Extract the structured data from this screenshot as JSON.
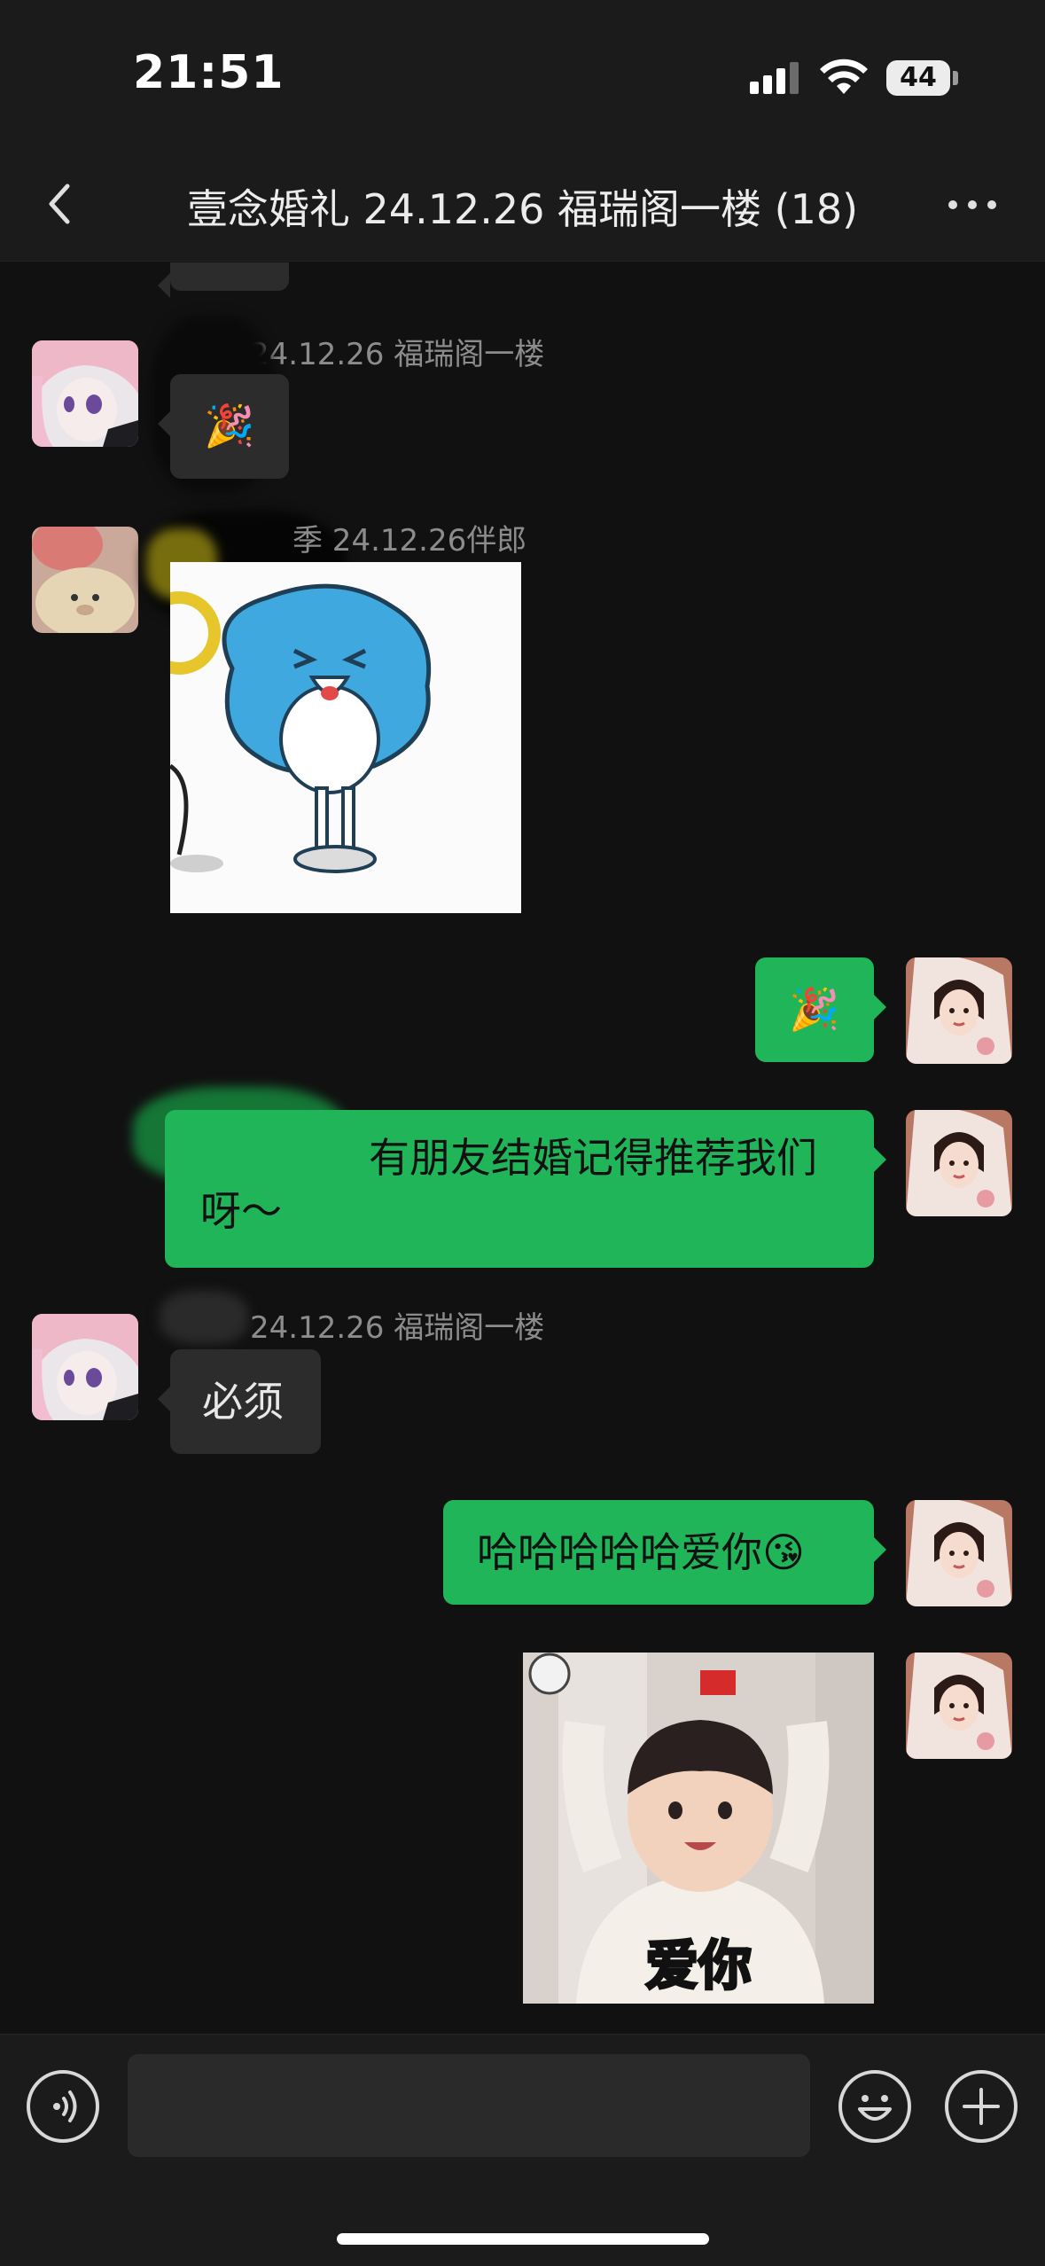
{
  "status_bar": {
    "time": "21:51",
    "battery": "44"
  },
  "nav": {
    "title": "壹念婚礼 24.12.26 福瑞阁一楼 (18)",
    "back_icon": "chevron-left-icon",
    "more_icon": "more-dots-icon"
  },
  "messages": [
    {
      "sender": "24.12.26 福瑞阁一楼",
      "text": "🎉",
      "direction": "in"
    },
    {
      "sender": "季 24.12.26伴郎",
      "sticker": "blue-dog-sticker",
      "direction": "in"
    },
    {
      "text": "🎉",
      "direction": "out"
    },
    {
      "text_line1": "有朋友结婚记得推荐我们",
      "text_line2": "呀～",
      "direction": "out"
    },
    {
      "sender": "24.12.26 福瑞阁一楼",
      "text": "必须",
      "direction": "in"
    },
    {
      "text": "哈哈哈哈哈爱你😘",
      "direction": "out"
    },
    {
      "sticker": "toddler-sticker",
      "caption": "爱你",
      "direction": "out"
    }
  ],
  "input_bar": {
    "voice_icon": "voice-icon",
    "emoji_icon": "emoji-icon",
    "plus_icon": "plus-icon",
    "placeholder": ""
  },
  "colors": {
    "background": "#111111",
    "bar": "#1b1b1b",
    "incoming_bubble": "#2c2c2c",
    "outgoing_bubble": "#21b55a",
    "sender_text": "#8c8c8c"
  }
}
